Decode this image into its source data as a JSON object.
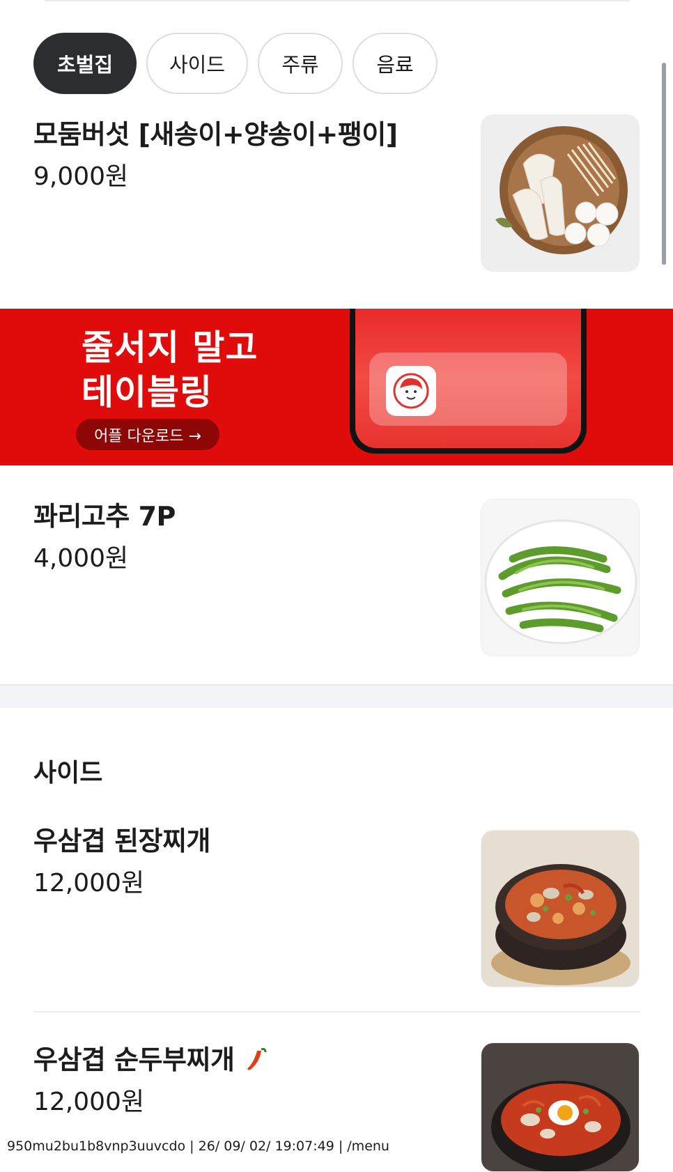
{
  "categories": [
    {
      "label": "초벌집",
      "active": true
    },
    {
      "label": "사이드",
      "active": false
    },
    {
      "label": "주류",
      "active": false
    },
    {
      "label": "음료",
      "active": false
    }
  ],
  "items_top": [
    {
      "name": "모둠버섯 [새송이+양송이+팽이]",
      "price": "9,000원",
      "image": "mushroom-platter"
    },
    {
      "name": "꽈리고추 7P",
      "price": "4,000원",
      "image": "green-peppers"
    }
  ],
  "banner": {
    "line1": "줄서지 말고",
    "line2": "테이블링",
    "button_label": "어플 다운로드 →",
    "background": "#e00b0b"
  },
  "side_section": {
    "title": "사이드",
    "items": [
      {
        "name": "우삼겹 된장찌개",
        "price": "12,000원",
        "image": "doenjang-stew"
      },
      {
        "name": "우삼겹 순두부찌개",
        "price": "12,000원",
        "image": "sundubu-stew",
        "badge": "chili-pepper-icon"
      }
    ]
  },
  "footer": {
    "text": "950mu2bu1b8vnp3uuvcdo | 26/ 09/ 02/ 19:07:49 | /menu"
  },
  "colors": {
    "active_tab": "#2b2d31",
    "brand_red": "#e00b0b"
  }
}
